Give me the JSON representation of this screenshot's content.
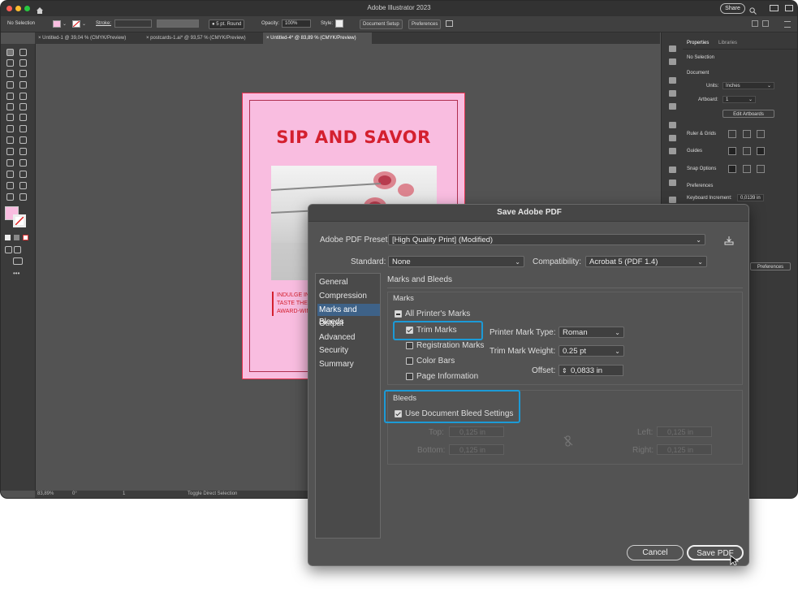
{
  "app": {
    "title": "Adobe Illustrator 2023",
    "share_label": "Share"
  },
  "control_bar": {
    "selection": "No Selection",
    "stroke_label": "Stroke:",
    "brush": "5 pt. Round",
    "opacity_label": "Opacity:",
    "opacity_value": "100%",
    "style_label": "Style:",
    "document_setup": "Document Setup",
    "preferences": "Preferences"
  },
  "tabs": [
    {
      "label": "Untitled-1 @ 39,04 % (CMYK/Preview)"
    },
    {
      "label": "postcards-1.ai* @ 93,57 % (CMYK/Preview)"
    },
    {
      "label": "Untitled-4* @ 83,89 % (CMYK/Preview)"
    }
  ],
  "status_bar": {
    "zoom": "83,89%",
    "rotation": "0°",
    "artboard": "1",
    "tool": "Toggle Direct Selection"
  },
  "properties": {
    "tab_properties": "Properties",
    "tab_libraries": "Libraries",
    "no_selection": "No Selection",
    "document": "Document",
    "units_label": "Units:",
    "units_value": "Inches",
    "artboard_label": "Artboard:",
    "artboard_value": "1",
    "edit_artboards": "Edit Artboards",
    "ruler_grids": "Ruler & Grids",
    "guides": "Guides",
    "snap_options": "Snap Options",
    "preferences": "Preferences",
    "keyboard_increment": "Keyboard Increment:",
    "keyboard_increment_value": "0,0139 in",
    "preferences_button": "Preferences"
  },
  "artwork": {
    "headline": "SIP AND SAVOR",
    "body": [
      "INDULGE IN",
      "TASTE THE",
      "AWARD-WIN"
    ]
  },
  "dialog": {
    "title": "Save Adobe PDF",
    "preset_label": "Adobe PDF Preset:",
    "preset_value": "[High Quality Print] (Modified)",
    "standard_label": "Standard:",
    "standard_value": "None",
    "compat_label": "Compatibility:",
    "compat_value": "Acrobat 5 (PDF 1.4)",
    "categories": [
      "General",
      "Compression",
      "Marks and Bleeds",
      "Output",
      "Advanced",
      "Security",
      "Summary"
    ],
    "section_title": "Marks and Bleeds",
    "marks": {
      "group_label": "Marks",
      "all_printers_marks": "All Printer's Marks",
      "trim_marks": "Trim Marks",
      "registration_marks": "Registration Marks",
      "color_bars": "Color Bars",
      "page_information": "Page Information",
      "printer_mark_type_label": "Printer Mark Type:",
      "printer_mark_type_value": "Roman",
      "trim_mark_weight_label": "Trim Mark Weight:",
      "trim_mark_weight_value": "0.25 pt",
      "offset_label": "Offset:",
      "offset_value": "0,0833 in"
    },
    "bleeds": {
      "group_label": "Bleeds",
      "use_document_bleed": "Use Document Bleed Settings",
      "top_label": "Top:",
      "bottom_label": "Bottom:",
      "left_label": "Left:",
      "right_label": "Right:",
      "value": "0,125 in"
    },
    "cancel_label": "Cancel",
    "save_label": "Save PDF"
  },
  "colors": {
    "highlight": "#1c9ad6",
    "artboard_pink": "#f9bde0",
    "headline_red": "#d4202f"
  }
}
